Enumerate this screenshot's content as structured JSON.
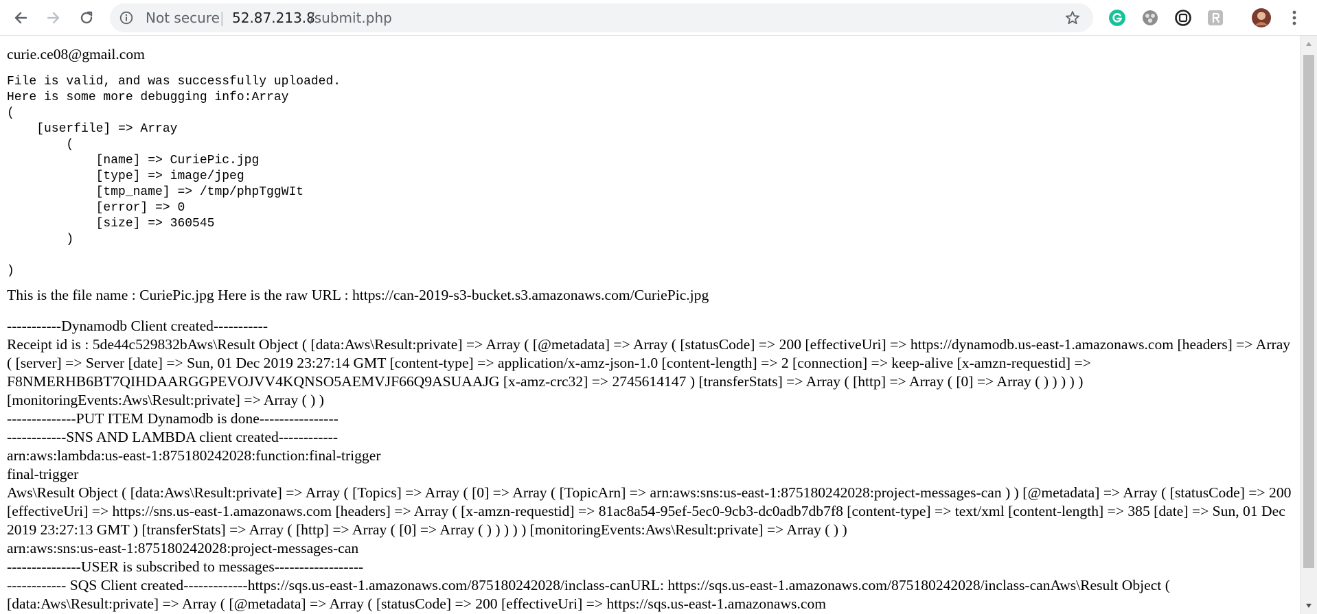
{
  "browser": {
    "security_label": "Not secure",
    "separator": "|",
    "url_host": "52.87.213.8",
    "url_path": "/submit.php",
    "icons": [
      "back-arrow-icon",
      "forward-arrow-icon",
      "reload-icon",
      "info-icon",
      "star-icon",
      "grammarly-icon",
      "extension-icon",
      "extension-icon",
      "extension-icon",
      "avatar",
      "more-menu-icon"
    ],
    "colors": {
      "grammarly": "#15c39a",
      "omnibox": "#f1f3f4"
    }
  },
  "page": {
    "email": "curie.ce08@gmail.com",
    "debug_block": "File is valid, and was successfully uploaded.\nHere is some more debugging info:Array\n(\n    [userfile] => Array\n        (\n            [name] => CuriePic.jpg\n            [type] => image/jpeg\n            [tmp_name] => /tmp/phpTggWIt\n            [error] => 0\n            [size] => 360545\n        )\n\n)",
    "file_line": "This is the file name : CuriePic.jpg Here is the raw URL : https://can-2019-s3-bucket.s3.amazonaws.com/CuriePic.jpg",
    "log_lines": [
      "-----------Dynamodb Client created-----------",
      "Receipt id is : 5de44c529832bAws\\Result Object ( [data:Aws\\Result:private] => Array ( [@metadata] => Array ( [statusCode] => 200 [effectiveUri] => https://dynamodb.us-east-1.amazonaws.com [headers] => Array ( [server] => Server [date] => Sun, 01 Dec 2019 23:27:14 GMT [content-type] => application/x-amz-json-1.0 [content-length] => 2 [connection] => keep-alive [x-amzn-requestid] => F8NMERHB6BT7QIHDAARGGPEVOJVV4KQNSO5AEMVJF66Q9ASUAAJG [x-amz-crc32] => 2745614147 ) [transferStats] => Array ( [http] => Array ( [0] => Array ( ) ) ) ) ) [monitoringEvents:Aws\\Result:private] => Array ( ) )",
      "--------------PUT ITEM Dynamodb is done----------------",
      "------------SNS AND LAMBDA client created------------",
      "arn:aws:lambda:us-east-1:875180242028:function:final-trigger",
      "final-trigger",
      "Aws\\Result Object ( [data:Aws\\Result:private] => Array ( [Topics] => Array ( [0] => Array ( [TopicArn] => arn:aws:sns:us-east-1:875180242028:project-messages-can ) ) [@metadata] => Array ( [statusCode] => 200 [effectiveUri] => https://sns.us-east-1.amazonaws.com [headers] => Array ( [x-amzn-requestid] => 81ac8a54-95ef-5ec0-9cb3-dc0adb7db7f8 [content-type] => text/xml [content-length] => 385 [date] => Sun, 01 Dec 2019 23:27:13 GMT ) [transferStats] => Array ( [http] => Array ( [0] => Array ( ) ) ) ) ) [monitoringEvents:Aws\\Result:private] => Array ( ) )",
      "arn:aws:sns:us-east-1:875180242028:project-messages-can",
      "---------------USER is subscribed to messages------------------",
      "------------ SQS Client created-------------https://sqs.us-east-1.amazonaws.com/875180242028/inclass-canURL: https://sqs.us-east-1.amazonaws.com/875180242028/inclass-canAws\\Result Object ( [data:Aws\\Result:private] => Array ( [@metadata] => Array ( [statusCode] => 200 [effectiveUri] => https://sqs.us-east-1.amazonaws.com"
    ]
  }
}
